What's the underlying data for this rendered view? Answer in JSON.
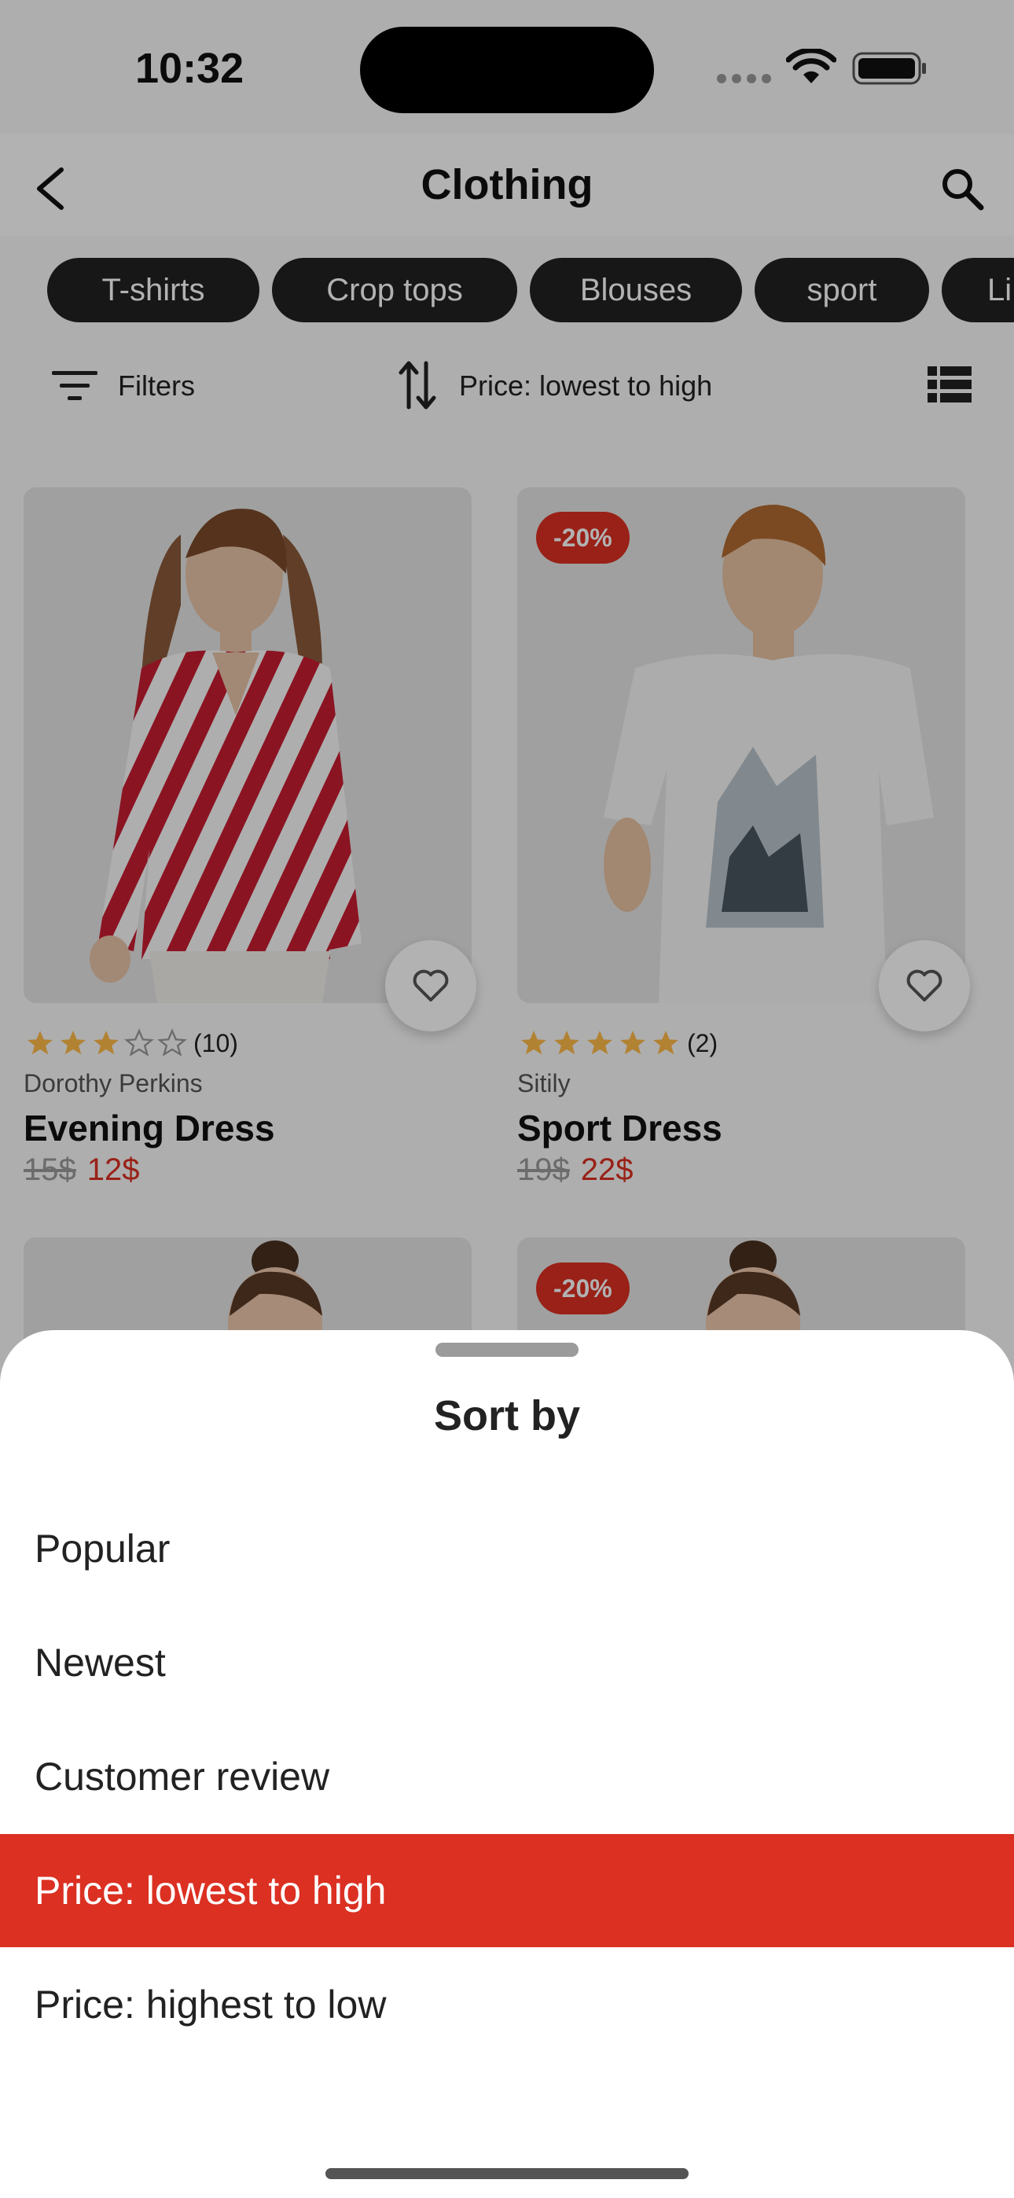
{
  "status": {
    "time": "10:32"
  },
  "header": {
    "title": "Clothing"
  },
  "categories": [
    "T-shirts",
    "Crop tops",
    "Blouses",
    "sport",
    "Li"
  ],
  "toolbar": {
    "filters_label": "Filters",
    "sort_label": "Price: lowest to high"
  },
  "products": [
    {
      "rating_count": "(10)",
      "stars": 3,
      "brand": "Dorothy Perkins",
      "name": "Evening Dress",
      "old_price": "15$",
      "new_price": "12$",
      "badge": ""
    },
    {
      "rating_count": "(2)",
      "stars": 5,
      "brand": "Sitily",
      "name": "Sport Dress",
      "old_price": "19$",
      "new_price": "22$",
      "badge": "-20%"
    },
    {
      "badge": ""
    },
    {
      "badge": "-20%"
    }
  ],
  "sort_sheet": {
    "title": "Sort by",
    "options": [
      "Popular",
      "Newest",
      "Customer review",
      "Price: lowest to high",
      "Price: highest to low"
    ],
    "selected": "Price: lowest to high"
  },
  "colors": {
    "accent": "#DB3022",
    "dark": "#222222",
    "star": "#FFBA49"
  }
}
